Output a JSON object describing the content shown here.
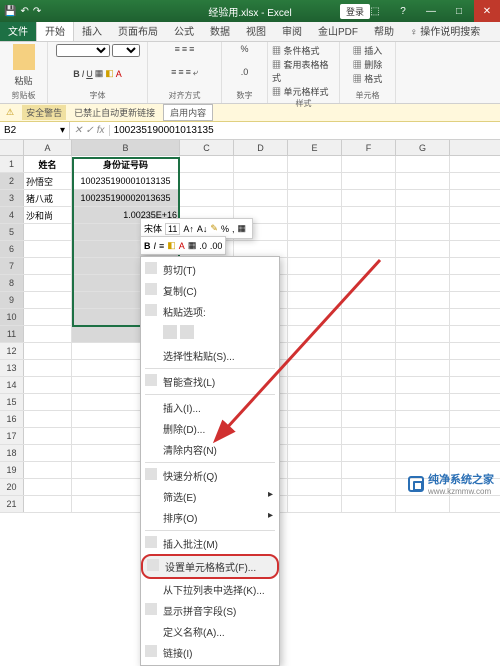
{
  "title": "经验用.xlsx - Excel",
  "login": "登录",
  "win": {
    "min": "—",
    "max": "□",
    "close": "✕",
    "help": "?",
    "ropt": "⬚"
  },
  "tabs": {
    "file": "文件",
    "home": "开始",
    "insert": "插入",
    "layout": "页面布局",
    "formula": "公式",
    "data": "数据",
    "review": "视图",
    "view": "审阅",
    "kwps": "金山PDF",
    "help": "帮助",
    "tell": "操作说明搜索"
  },
  "groups": {
    "clipboard": "剪贴板",
    "font": "字体",
    "align": "对齐方式",
    "number": "数字",
    "styles": "样式",
    "cells": "单元格"
  },
  "clipboard": {
    "paste": "粘贴",
    "cut": "剪切",
    "copy": "复制"
  },
  "font": {
    "name": "",
    "size": "",
    "bold": "B",
    "italic": "I",
    "underline": "U"
  },
  "styles": {
    "cond": "条件格式",
    "table": "套用表格格式",
    "cell": "单元格样式"
  },
  "cells": {
    "insert": "插入",
    "delete": "删除",
    "format": "格式"
  },
  "warn": {
    "label": "安全警告",
    "msg": "已禁止自动更新链接",
    "enable": "启用内容"
  },
  "namebox": "B2",
  "formula": "100235190001013135",
  "cols": [
    "A",
    "B",
    "C",
    "D",
    "E",
    "F",
    "G"
  ],
  "rows": [
    "1",
    "2",
    "3",
    "4",
    "5",
    "6",
    "7",
    "8",
    "9",
    "10",
    "11",
    "12",
    "13",
    "14",
    "15",
    "16",
    "17",
    "18",
    "19",
    "20",
    "21"
  ],
  "data": {
    "A1": "姓名",
    "B1": "身份证号码",
    "A2": "孙悟空",
    "B2": "100235190001013135",
    "A3": "猪八戒",
    "B3": "100235190002013635",
    "A4": "沙和尚",
    "B4": "1.00235E+16"
  },
  "mini": {
    "font": "宋体",
    "size": "11",
    "bold": "B",
    "italic": "I"
  },
  "ctx": {
    "cut": "剪切(T)",
    "copy": "复制(C)",
    "pasteopt": "粘贴选项:",
    "pastespecial": "选择性粘贴(S)...",
    "smartlookup": "智能查找(L)",
    "insert": "插入(I)...",
    "delete": "删除(D)...",
    "clear": "清除内容(N)",
    "quickanalysis": "快速分析(Q)",
    "filter": "筛选(E)",
    "sort": "排序(O)",
    "comment": "插入批注(M)",
    "formatcells": "设置单元格格式(F)...",
    "dropdown": "从下拉列表中选择(K)...",
    "phonetic": "显示拼音字段(S)",
    "definename": "定义名称(A)...",
    "link": "链接(I)"
  },
  "watermark": "纯净系统之家",
  "wmurl": "www.kzmmw.com"
}
